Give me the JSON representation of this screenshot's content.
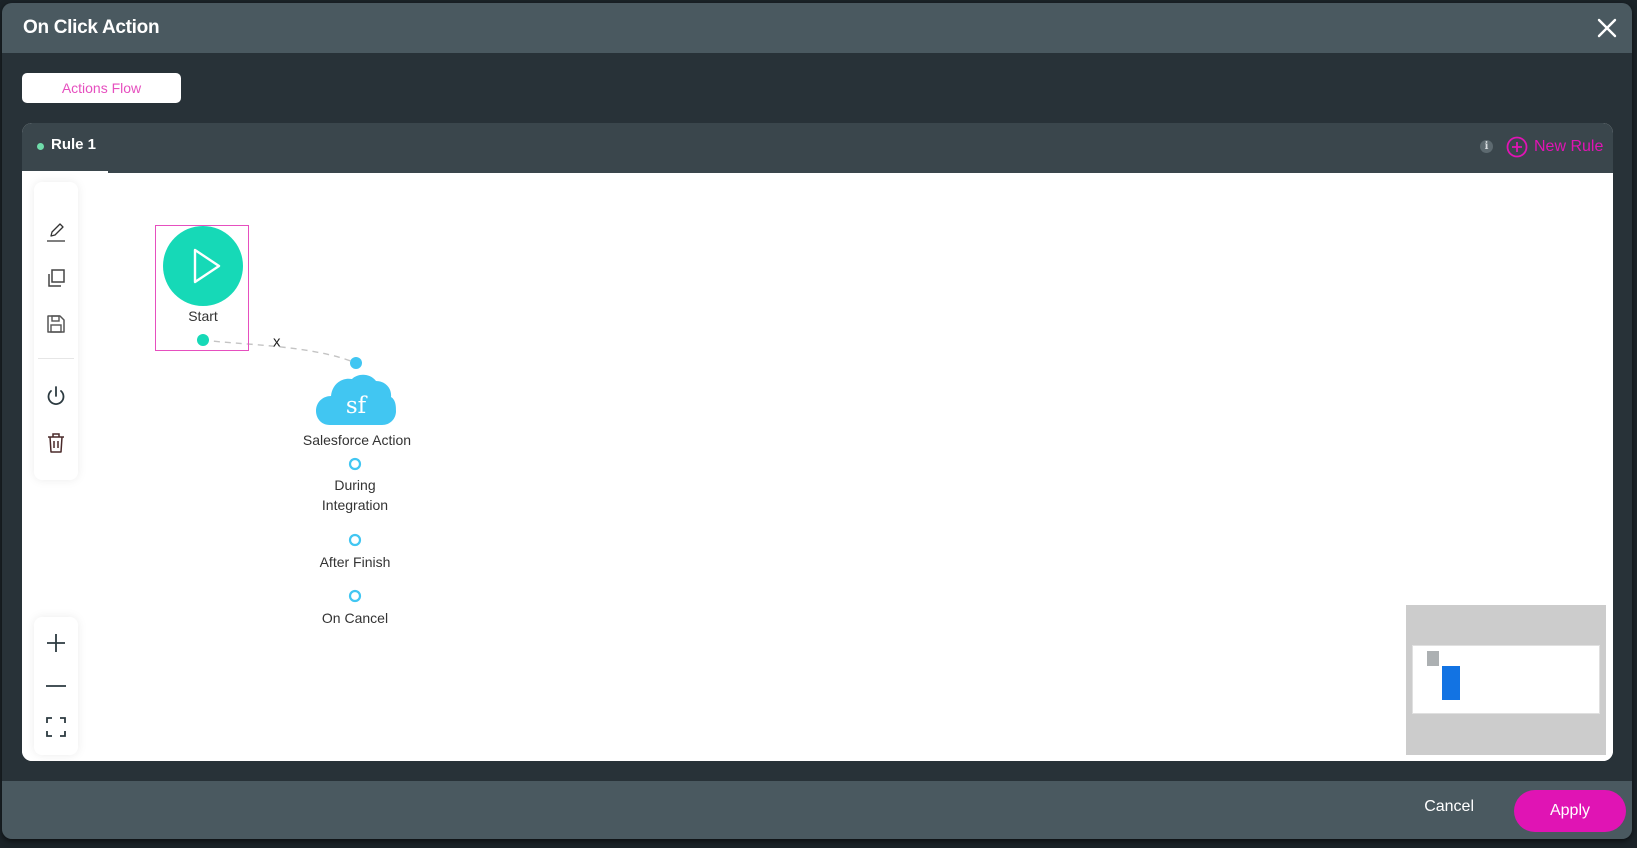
{
  "dialog": {
    "title": "On Click Action",
    "close_icon": "close-icon"
  },
  "tabs": [
    {
      "label": "Actions Flow",
      "active": true
    }
  ],
  "rules": {
    "items": [
      {
        "label": "Rule 1",
        "status_color": "#6fdcaa",
        "active": true
      }
    ],
    "info_icon": "i",
    "new_rule_label": "New Rule"
  },
  "toolbar": {
    "items": [
      {
        "name": "edit",
        "icon": "pencil-icon"
      },
      {
        "name": "duplicate",
        "icon": "copy-icon"
      },
      {
        "name": "save",
        "icon": "save-icon"
      },
      {
        "name": "toggle-power",
        "icon": "power-icon"
      },
      {
        "name": "delete",
        "icon": "trash-icon"
      }
    ]
  },
  "zoom_controls": [
    {
      "name": "zoom-in",
      "icon": "plus-icon"
    },
    {
      "name": "zoom-out",
      "icon": "minus-icon"
    },
    {
      "name": "fit-to-screen",
      "icon": "fit-screen-icon"
    }
  ],
  "flow": {
    "nodes": [
      {
        "id": "start",
        "label": "Start",
        "type": "start",
        "selected": true,
        "color": "#16d9b7"
      },
      {
        "id": "salesforce",
        "label": "Salesforce Action",
        "type": "salesforce",
        "icon_text": "sf",
        "color": "#41c6f2",
        "outputs": [
          {
            "label_line1": "During",
            "label_line2": "Integration"
          },
          {
            "label_line1": "After Finish"
          },
          {
            "label_line1": "On Cancel"
          }
        ]
      }
    ],
    "edges": [
      {
        "from": "start",
        "to": "salesforce",
        "remove_label": "x"
      }
    ]
  },
  "footer": {
    "cancel_label": "Cancel",
    "apply_label": "Apply"
  },
  "colors": {
    "accent": "#e014b4",
    "selection": "#e64fbf",
    "start_node": "#16d9b7",
    "salesforce_node": "#41c6f2",
    "minimap_node": "#1273e3"
  }
}
